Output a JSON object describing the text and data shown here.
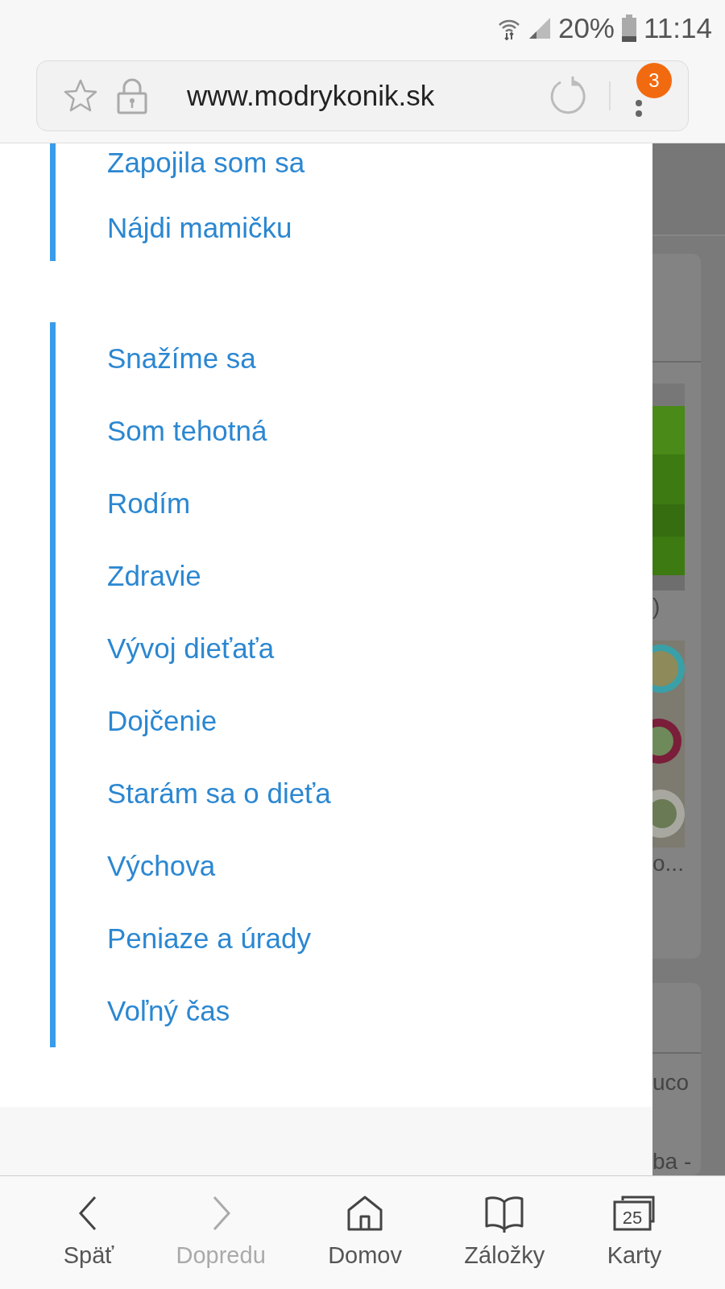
{
  "status_bar": {
    "battery": "20%",
    "time": "11:14"
  },
  "address_bar": {
    "url": "www.modrykonik.sk",
    "menu_badge": "3"
  },
  "menu_groups": [
    {
      "items": [
        {
          "label": "Zapojila som sa"
        },
        {
          "label": "Nájdi mamičku"
        }
      ]
    },
    {
      "items": [
        {
          "label": "Snažíme sa"
        },
        {
          "label": "Som tehotná"
        },
        {
          "label": "Rodím"
        },
        {
          "label": "Zdravie"
        },
        {
          "label": "Vývoj dieťaťa"
        },
        {
          "label": "Dojčenie"
        },
        {
          "label": "Starám sa o dieťa"
        },
        {
          "label": "Výchova"
        },
        {
          "label": "Peniaze a úrady"
        },
        {
          "label": "Voľný čas"
        }
      ]
    }
  ],
  "background_cards": [
    {
      "entries": [
        {
          "kind": "picture",
          "caption": ")"
        },
        {
          "kind": "picture",
          "caption": "o..."
        }
      ]
    },
    {
      "entries": [
        {
          "kind": "text",
          "caption": "uco"
        },
        {
          "kind": "text",
          "caption": "ba -"
        }
      ]
    }
  ],
  "bottom_nav": [
    {
      "kind": "back",
      "label": "Späť",
      "disabled": false
    },
    {
      "kind": "forward",
      "label": "Dopredu",
      "disabled": true
    },
    {
      "kind": "home",
      "label": "Domov",
      "disabled": false
    },
    {
      "kind": "bookmarks",
      "label": "Záložky",
      "disabled": false
    },
    {
      "kind": "tabs",
      "label": "Karty",
      "count": "25",
      "disabled": false
    }
  ]
}
